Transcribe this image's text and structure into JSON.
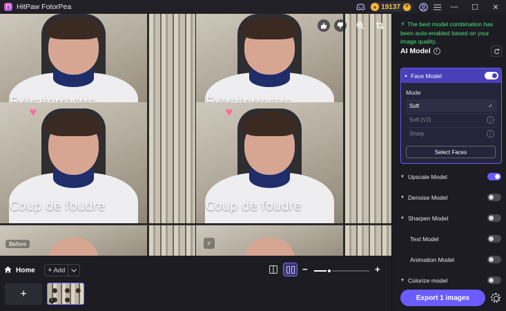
{
  "app": {
    "title": "HitPaw FotorPea"
  },
  "titlebar": {
    "coins": "19137",
    "coin_add": "+"
  },
  "window": {
    "minimize": "—",
    "maximize": "☐",
    "close": "✕"
  },
  "preview": {
    "captions": [
      "Extraterrestre",
      "Coup de foudre"
    ],
    "before_label": "Before",
    "check": "✓"
  },
  "bottom": {
    "home_label": "Home",
    "add_label": "Add",
    "add_plus": "+",
    "add_tile_plus": "+",
    "zoom_level": 0.27,
    "thumb_info": "i"
  },
  "panel": {
    "notice": "The best model combination has been auto-enabled based on your image quality.",
    "ai_model_title": "AI Model",
    "face_model": {
      "label": "Face Model",
      "enabled": true,
      "mode_label": "Mode",
      "options": [
        {
          "label": "Soft",
          "selected": true,
          "status": "✓"
        },
        {
          "label": "Soft (V2)",
          "selected": false,
          "status": "↓"
        },
        {
          "label": "Sharp",
          "selected": false,
          "status": "↓"
        }
      ],
      "select_faces": "Select Faces"
    },
    "models": [
      {
        "label": "Upscale Model",
        "enabled": true,
        "expandable": true
      },
      {
        "label": "Denoise Model",
        "enabled": false,
        "expandable": true
      },
      {
        "label": "Sharpen Model",
        "enabled": false,
        "expandable": true
      },
      {
        "label": "Text Model",
        "enabled": false,
        "expandable": false
      },
      {
        "label": "Animation Model",
        "enabled": false,
        "expandable": false
      },
      {
        "label": "Colorize model",
        "enabled": false,
        "expandable": true
      }
    ],
    "export_label": "Export 1 images"
  },
  "colors": {
    "accent": "#6a5cff",
    "notice": "#52e07c",
    "coin": "#f3b635"
  }
}
